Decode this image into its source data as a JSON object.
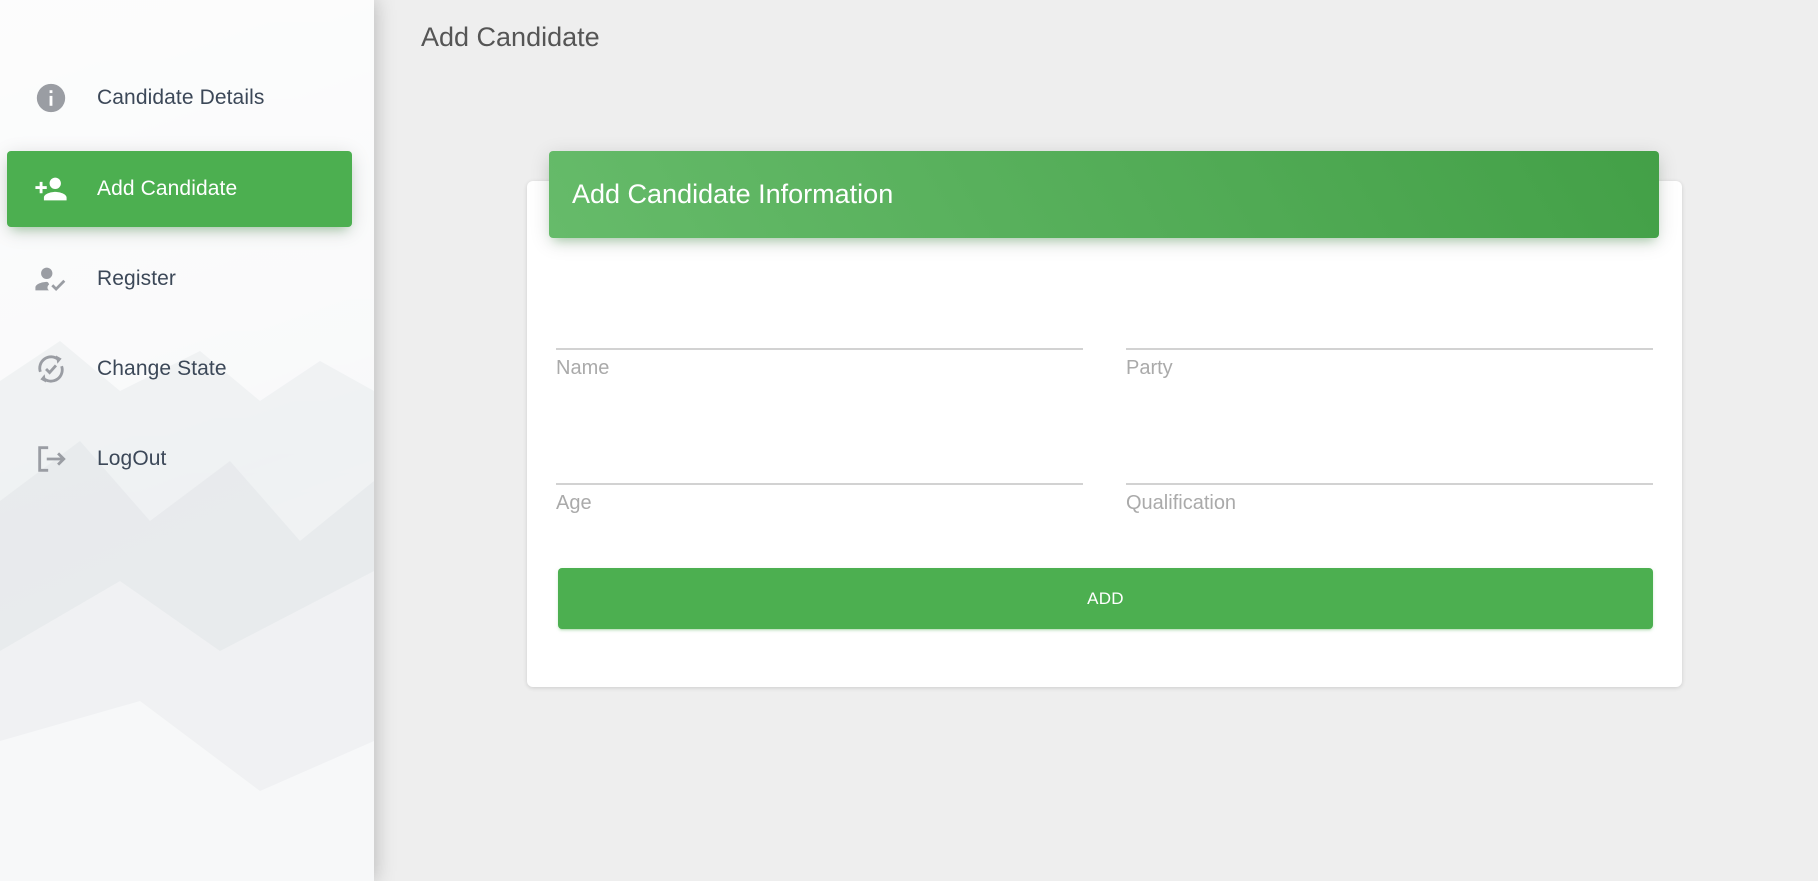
{
  "sidebar": {
    "items": [
      {
        "label": "Candidate Details",
        "icon": "info-icon",
        "active": false
      },
      {
        "label": "Add Candidate",
        "icon": "person-add-icon",
        "active": true
      },
      {
        "label": "Register",
        "icon": "how-to-reg-icon",
        "active": false
      },
      {
        "label": "Change State",
        "icon": "sync-check-icon",
        "active": false
      },
      {
        "label": "LogOut",
        "icon": "logout-icon",
        "active": false
      }
    ]
  },
  "header": {
    "title": "Add Candidate"
  },
  "card": {
    "title": "Add Candidate Information",
    "fields": {
      "name": {
        "label": "Name",
        "value": ""
      },
      "party": {
        "label": "Party",
        "value": ""
      },
      "age": {
        "label": "Age",
        "value": ""
      },
      "qualification": {
        "label": "Qualification",
        "value": ""
      }
    },
    "submit_label": "ADD"
  },
  "colors": {
    "accent": "#4caf50",
    "header_gradient_start": "#66bb6a",
    "header_gradient_end": "#43a047",
    "page_background": "#eeeeee",
    "text": "#3c4858",
    "field_label": "#aaaaaa"
  }
}
